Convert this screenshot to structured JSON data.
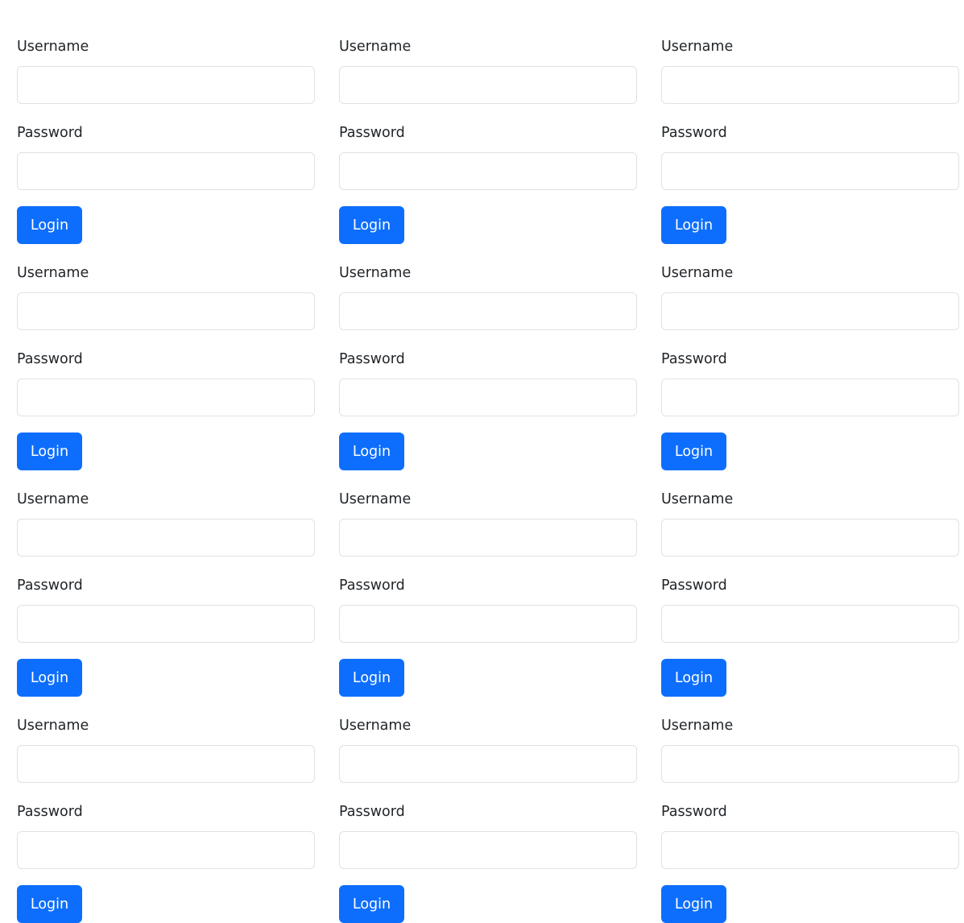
{
  "form": {
    "username_label": "Username",
    "password_label": "Password",
    "login_label": "Login",
    "username_value": "",
    "password_value": ""
  },
  "grid": {
    "columns": 3,
    "visible_rows": 4
  },
  "colors": {
    "primary": "#0d6efd",
    "input_border": "#dee2e6",
    "text": "#212529",
    "background": "#ffffff"
  }
}
